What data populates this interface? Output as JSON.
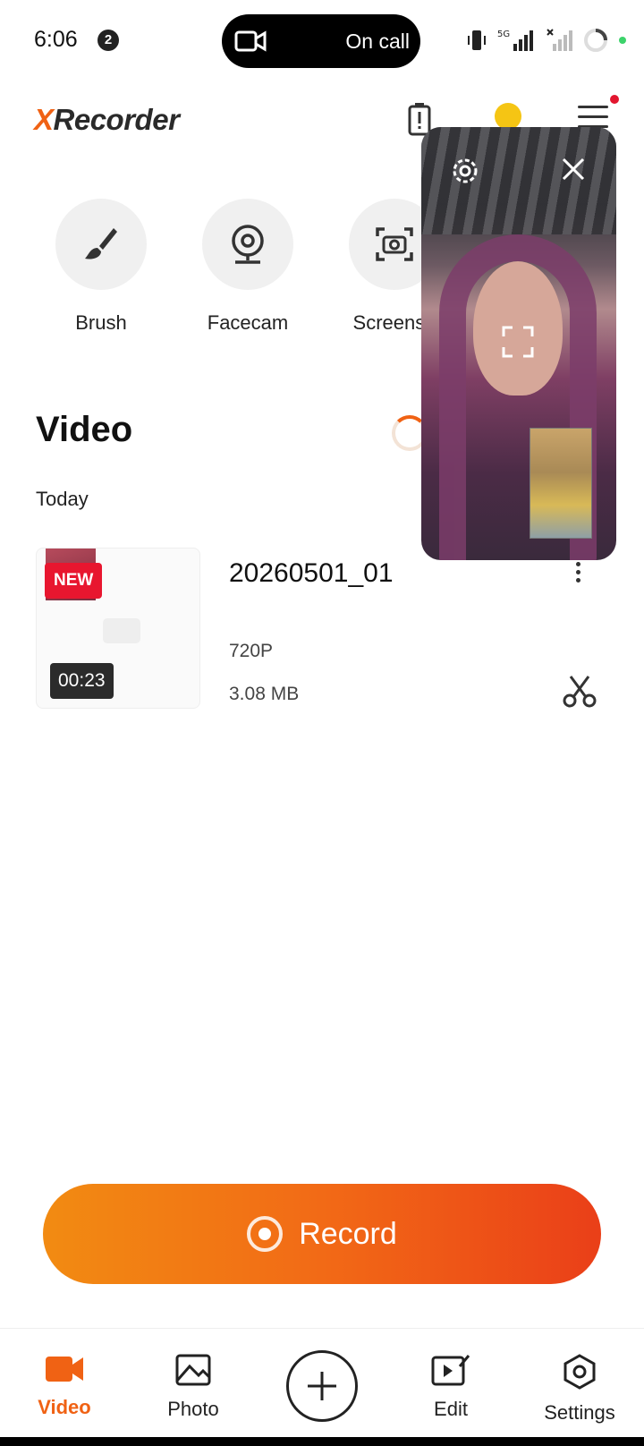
{
  "status_bar": {
    "time": "6:06",
    "notification_count": "2",
    "call_text": "On call"
  },
  "header": {
    "logo_prefix": "X",
    "logo_rest": "Recorder"
  },
  "tools": [
    {
      "label": "Brush",
      "icon": "brush-icon"
    },
    {
      "label": "Facecam",
      "icon": "webcam-icon"
    },
    {
      "label": "Screensh",
      "icon": "screenshot-icon"
    }
  ],
  "section": {
    "title": "Video",
    "group": "Today"
  },
  "video": {
    "badge": "NEW",
    "duration": "00:23",
    "name": "20260501_01",
    "resolution": "720P",
    "size": "3.08 MB"
  },
  "record": {
    "label": "Record"
  },
  "nav": [
    {
      "label": "Video",
      "icon": "video-camera-icon",
      "active": true
    },
    {
      "label": "Photo",
      "icon": "photo-icon",
      "active": false
    },
    {
      "label": "",
      "icon": "plus-icon",
      "active": false
    },
    {
      "label": "Edit",
      "icon": "edit-video-icon",
      "active": false
    },
    {
      "label": "Settings",
      "icon": "settings-icon",
      "active": false
    }
  ],
  "colors": {
    "accent": "#f06214",
    "record_gradient_start": "#f28b12",
    "record_gradient_end": "#ea3f18",
    "badge_red": "#e8162f"
  }
}
